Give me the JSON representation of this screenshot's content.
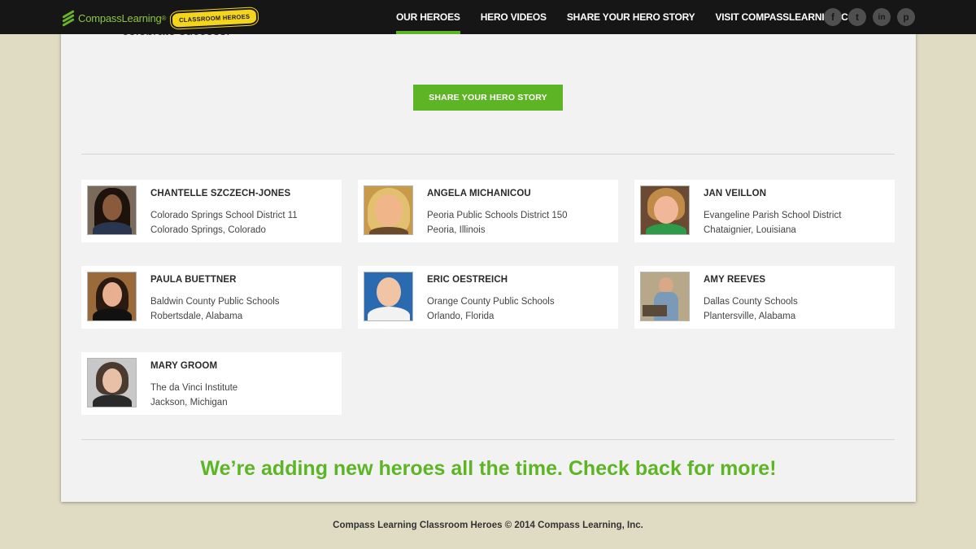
{
  "header": {
    "logo_text": "CompassLearning",
    "logo_registered": "®",
    "badge_text": "CLASSROOM HEROES",
    "nav": [
      {
        "label": "OUR HEROES",
        "active": true
      },
      {
        "label": "HERO VIDEOS",
        "active": false
      },
      {
        "label": "SHARE YOUR HERO STORY",
        "active": false
      },
      {
        "label": "VISIT COMPASSLEARNING.COM",
        "active": false
      }
    ],
    "social": [
      {
        "icon": "facebook-icon",
        "glyph": "f"
      },
      {
        "icon": "twitter-icon",
        "glyph": "t"
      },
      {
        "icon": "linkedin-icon",
        "glyph": "in"
      },
      {
        "icon": "pinterest-icon",
        "glyph": "p"
      }
    ]
  },
  "main": {
    "intro_tail": "celebrate success.",
    "share_button": "SHARE YOUR HERO STORY",
    "heroes": [
      {
        "name": "CHANTELLE SZCZECH-JONES",
        "school": "Colorado Springs School District 11",
        "place": "Colorado Springs, Colorado"
      },
      {
        "name": "ANGELA MICHANICOU",
        "school": "Peoria Public Schools District 150",
        "place": "Peoria, Illinois"
      },
      {
        "name": "JAN VEILLON",
        "school": "Evangeline Parish School District",
        "place": "Chataignier, Louisiana"
      },
      {
        "name": "PAULA BUETTNER",
        "school": "Baldwin County Public Schools",
        "place": "Robertsdale, Alabama"
      },
      {
        "name": "ERIC OESTREICH",
        "school": "Orange County Public Schools",
        "place": "Orlando, Florida"
      },
      {
        "name": "AMY REEVES",
        "school": "Dallas County Schools",
        "place": "Plantersville, Alabama"
      },
      {
        "name": "MARY GROOM",
        "school": "The da Vinci Institute",
        "place": "Jackson, Michigan"
      }
    ],
    "tagline": "We’re adding new heroes all the time. Check back for more!"
  },
  "footer": {
    "text": "Compass Learning Classroom Heroes © 2014 Compass Learning, Inc."
  },
  "colors": {
    "accent_green": "#5db525",
    "topbar": "#161616",
    "page_bg": "#e0dcc4",
    "panel_bg": "#f2f2f2"
  }
}
